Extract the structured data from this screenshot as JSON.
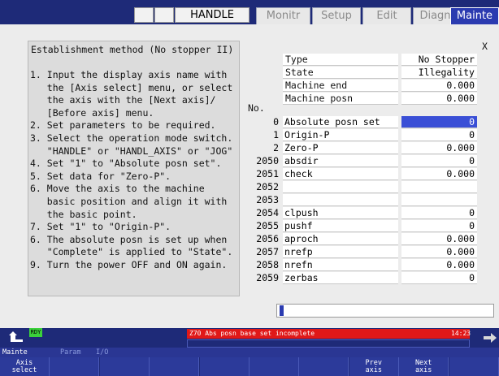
{
  "topbar": {
    "mode": "HANDLE",
    "tabs": [
      {
        "label": "Monitr",
        "active": false
      },
      {
        "label": "Setup",
        "active": false
      },
      {
        "label": "Edit",
        "active": false
      },
      {
        "label": "Diagn",
        "active": false
      },
      {
        "label": "Mainte",
        "active": true
      }
    ]
  },
  "procedure": {
    "title": "Establishment method (No stopper II)",
    "lines": [
      "1. Input the display axis name with",
      "   the [Axis select] menu, or select",
      "   the axis with the [Next axis]/",
      "   [Before axis] menu.",
      "2. Set parameters to be required.",
      "3. Select the operation mode switch.",
      "   \"HANDLE\" or \"HANDL_AXIS\" or \"JOG\"",
      "4. Set \"1\" to \"Absolute posn set\".",
      "5. Set data for \"Zero-P\".",
      "6. Move the axis to the machine",
      "   basic position and align it with",
      "   the basic point.",
      "7. Set \"1\" to \"Origin-P\".",
      "6. The absolute posn is set up when",
      "   \"Complete\" is applied to \"State\".",
      "9. Turn the power OFF and ON again."
    ]
  },
  "axis_label": "X",
  "status_table": [
    {
      "label": "Type",
      "value": "No Stopper"
    },
    {
      "label": "State",
      "value": "Illegality"
    },
    {
      "label": "Machine end",
      "value": "0.000"
    },
    {
      "label": "Machine posn",
      "value": "0.000"
    }
  ],
  "no_header": "No.",
  "params": [
    {
      "no": "0",
      "name": "Absolute posn set",
      "value": "0",
      "selected": true
    },
    {
      "no": "1",
      "name": "Origin-P",
      "value": "0"
    },
    {
      "no": "2",
      "name": "Zero-P",
      "value": "0.000"
    },
    {
      "no": "2050",
      "name": "absdir",
      "value": "0"
    },
    {
      "no": "2051",
      "name": "check",
      "value": "0.000"
    },
    {
      "no": "2052",
      "name": "",
      "value": ""
    },
    {
      "no": "2053",
      "name": "",
      "value": ""
    },
    {
      "no": "2054",
      "name": "clpush",
      "value": "0"
    },
    {
      "no": "2055",
      "name": "pushf",
      "value": "0"
    },
    {
      "no": "2056",
      "name": "aproch",
      "value": "0.000"
    },
    {
      "no": "2057",
      "name": "nrefp",
      "value": "0.000"
    },
    {
      "no": "2058",
      "name": "nrefn",
      "value": "0.000"
    },
    {
      "no": "2059",
      "name": "zerbas",
      "value": "0"
    }
  ],
  "status_bar": {
    "ready": "RDY",
    "message": "Z70  Abs posn base set incomplete",
    "time": "14:23",
    "menu_path": [
      "Mainte",
      "Param",
      "I/O"
    ]
  },
  "function_keys": [
    "Axis\nselect",
    "",
    "",
    "",
    "",
    "",
    "",
    "Prev\naxis",
    "Next\naxis",
    ""
  ],
  "colors": {
    "header_bg": "#1e2a78",
    "selected": "#3a4fd6",
    "alarm": "#e01818",
    "active_tab": "#2b3bb0"
  }
}
